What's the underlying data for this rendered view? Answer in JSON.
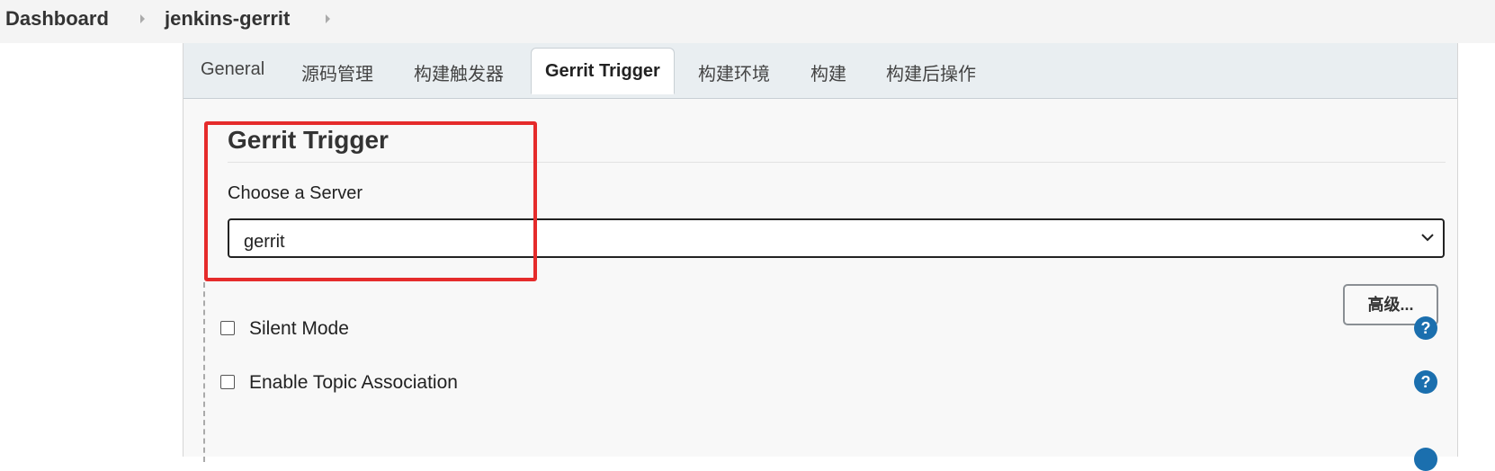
{
  "breadcrumb": {
    "items": [
      {
        "label": "Dashboard"
      },
      {
        "label": "jenkins-gerrit"
      }
    ]
  },
  "tabs": [
    {
      "label": "General",
      "active": false
    },
    {
      "label": "源码管理",
      "active": false
    },
    {
      "label": "构建触发器",
      "active": false
    },
    {
      "label": "Gerrit Trigger",
      "active": true
    },
    {
      "label": "构建环境",
      "active": false
    },
    {
      "label": "构建",
      "active": false
    },
    {
      "label": "构建后操作",
      "active": false
    }
  ],
  "section": {
    "title": "Gerrit Trigger",
    "server_label": "Choose a Server",
    "server_value": "gerrit"
  },
  "advanced_button": "高级...",
  "options": [
    {
      "label": "Silent Mode",
      "checked": false
    },
    {
      "label": "Enable Topic Association",
      "checked": false
    }
  ],
  "icons": {
    "help": "question-mark-circle-icon",
    "dropdown": "chevron-down-icon",
    "breadcrumb_separator": "caret-right-icon"
  },
  "colors": {
    "highlight": "#e52b2b",
    "help_icon": "#1b6fae",
    "tab_bar": "#e9eef1"
  }
}
